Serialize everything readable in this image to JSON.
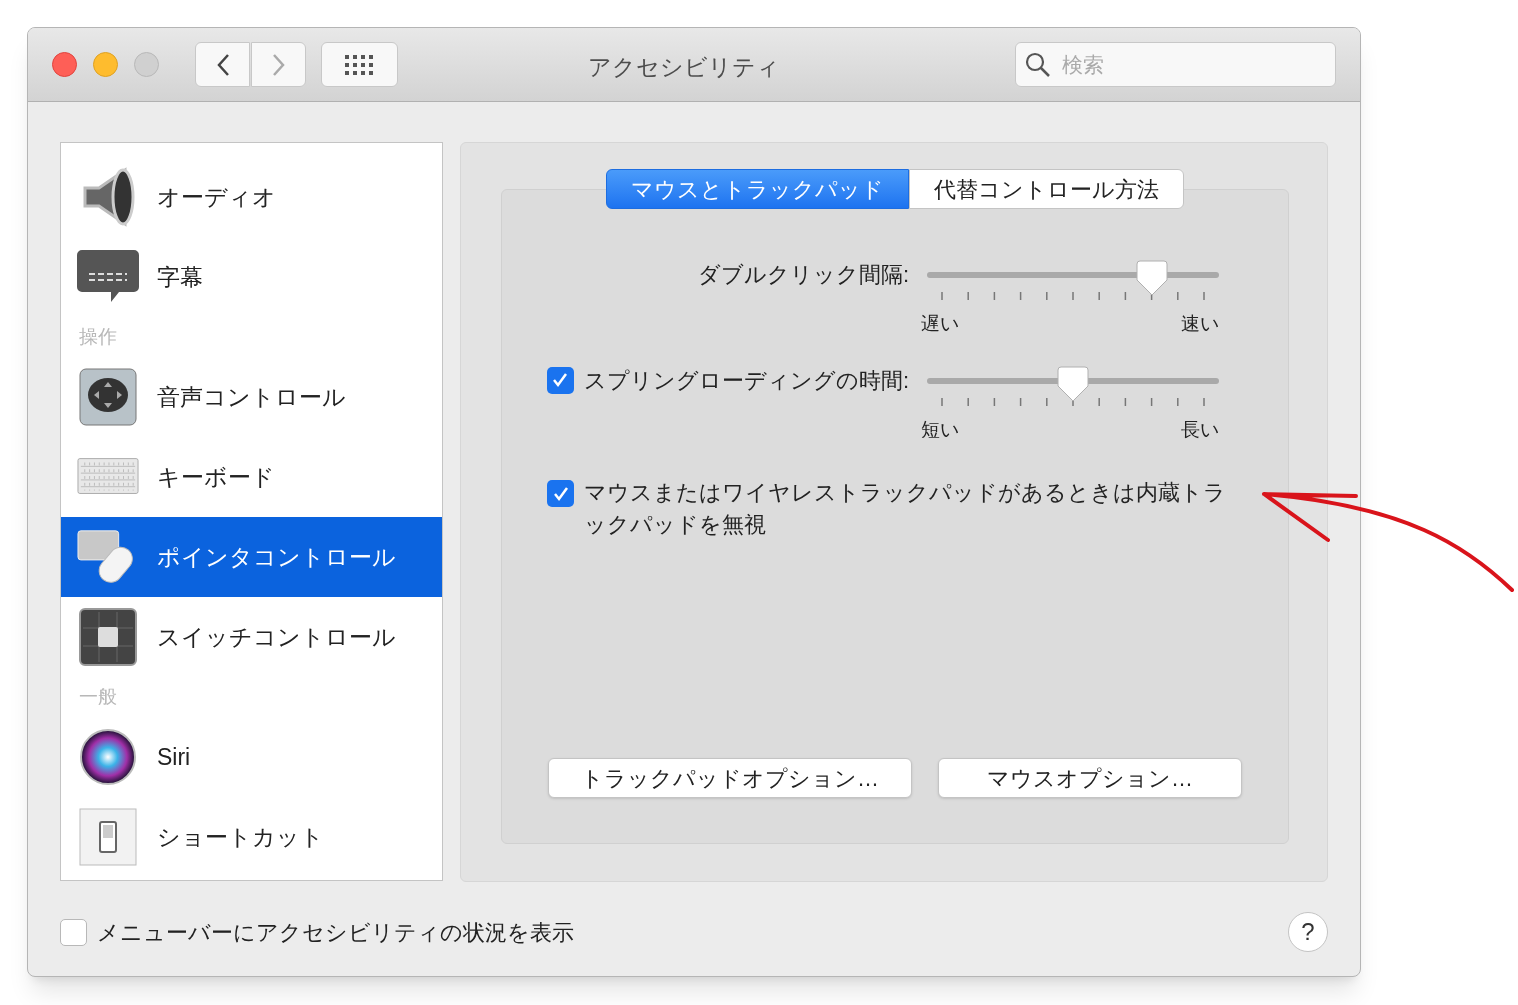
{
  "window": {
    "title": "アクセシビリティ"
  },
  "search": {
    "placeholder": "検索"
  },
  "sidebar": {
    "items": [
      {
        "kind": "item",
        "label": "オーディオ",
        "selected": false
      },
      {
        "kind": "item",
        "label": "字幕",
        "selected": false
      },
      {
        "kind": "header",
        "label": "操作"
      },
      {
        "kind": "item",
        "label": "音声コントロール",
        "selected": false
      },
      {
        "kind": "item",
        "label": "キーボード",
        "selected": false
      },
      {
        "kind": "item",
        "label": "ポインタコントロール",
        "selected": true
      },
      {
        "kind": "item",
        "label": "スイッチコントロール",
        "selected": false
      },
      {
        "kind": "header",
        "label": "一般"
      },
      {
        "kind": "item",
        "label": "Siri",
        "selected": false
      },
      {
        "kind": "item",
        "label": "ショートカット",
        "selected": false
      }
    ]
  },
  "tabs": [
    {
      "label": "マウスとトラックパッド",
      "selected": true
    },
    {
      "label": "代替コントロール方法",
      "selected": false
    }
  ],
  "settings": [
    {
      "kind": "slider",
      "label": "ダブルクリック間隔:",
      "level": 0.8,
      "min_label": "遅い",
      "max_label": "速い"
    },
    {
      "kind": "slider",
      "label": "スプリングローディングの時間:",
      "checked": true,
      "level": 0.5,
      "min_label": "短い",
      "max_label": "長い"
    },
    {
      "kind": "checkbox",
      "label": "マウスまたはワイヤレストラックパッドがあるときは内蔵トラックパッドを無視",
      "checked": true
    }
  ],
  "buttons": [
    "トラックパッドオプション…",
    "マウスオプション…"
  ],
  "footer": {
    "checkbox": {
      "label": "メニューバーにアクセシビリティの状況を表示",
      "checked": false
    },
    "help": "?"
  }
}
